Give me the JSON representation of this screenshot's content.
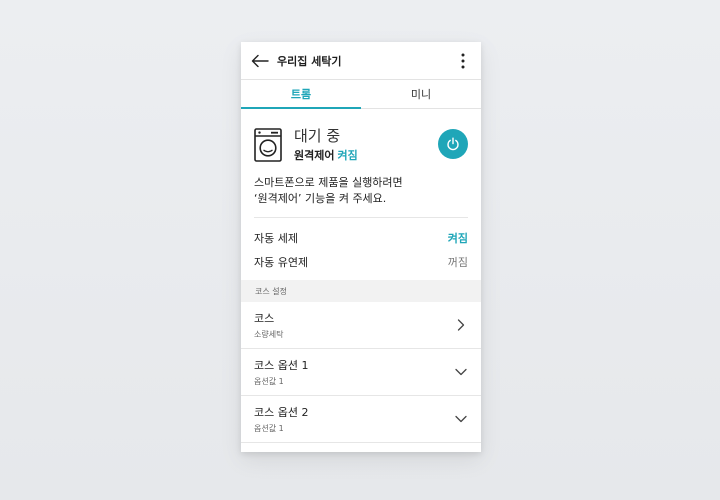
{
  "appbar": {
    "title": "우리집 세탁기",
    "back_icon": "arrow-left-icon",
    "more_icon": "more-vertical-icon"
  },
  "tabs": [
    {
      "label": "트롬",
      "active": true
    },
    {
      "label": "미니",
      "active": false
    }
  ],
  "status": {
    "title": "대기 중",
    "remote_label": "원격제어",
    "remote_value": "켜짐",
    "device_icon": "washing-machine-icon",
    "power_icon": "power-icon"
  },
  "notice": {
    "line1": "스마트폰으로 제품을 실행하려면",
    "line2": "‘원격제어’ 기능을 켜 주세요."
  },
  "toggles": [
    {
      "label": "자동 세제",
      "value": "켜짐",
      "on": true
    },
    {
      "label": "자동 유연제",
      "value": "꺼짐",
      "on": false
    }
  ],
  "course_section": {
    "header": "코스 설정",
    "items": [
      {
        "title": "코스",
        "subtitle": "소량세탁",
        "icon": "chevron-right-icon"
      },
      {
        "title": "코스 옵션 1",
        "subtitle": "옵션값 1",
        "icon": "chevron-down-icon"
      },
      {
        "title": "코스 옵션 2",
        "subtitle": "옵션값 1",
        "icon": "chevron-down-icon"
      }
    ]
  },
  "colors": {
    "accent": "#1fa6b8",
    "background": "#e9ebee",
    "card": "#ffffff",
    "section": "#f2f2f2"
  }
}
